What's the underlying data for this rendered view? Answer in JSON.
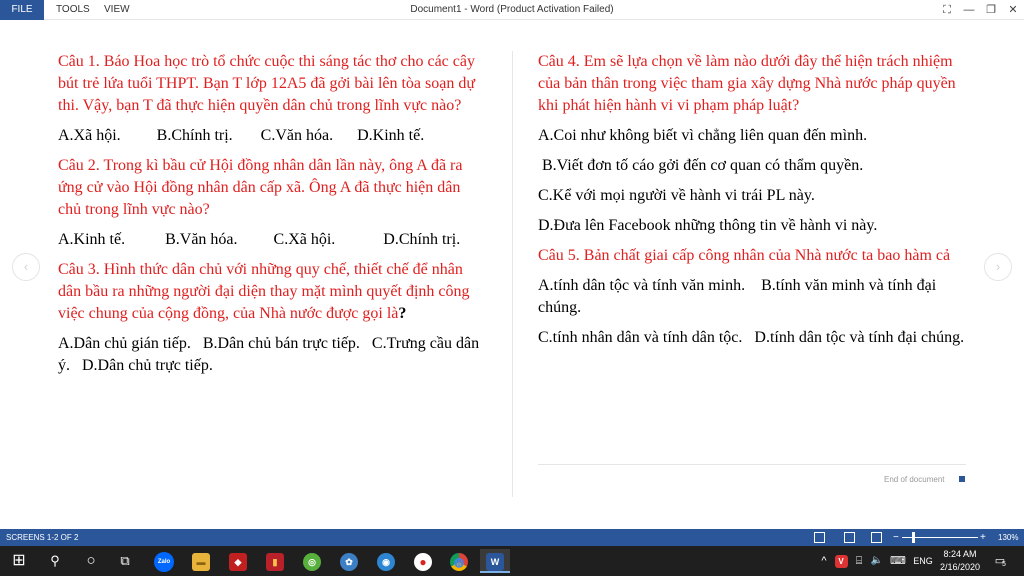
{
  "window": {
    "title": "Document1 - Word (Product Activation Failed)",
    "menu": {
      "file": "FILE",
      "tools": "TOOLS",
      "view": "VIEW"
    },
    "controls": {
      "toolbar": "⛶",
      "minimize": "—",
      "maximize": "❐",
      "close": "✕"
    }
  },
  "document": {
    "left_column": [
      {
        "type": "question",
        "text": "Câu 1. Báo Hoa học trò tổ chức cuộc thi sáng tác thơ cho các cây bút trẻ lứa tuổi THPT. Bạn T lớp 12A5 đã gởi bài lên tòa soạn dự thi. Vậy, bạn T đã thực hiện quyền dân chủ trong lĩnh vực nào?"
      },
      {
        "type": "answer",
        "text": "A.Xã hội.         B.Chính trị.       C.Văn hóa.      D.Kinh tế."
      },
      {
        "type": "question",
        "text": "Câu 2. Trong kì bầu cử Hội đồng nhân dân lần này, ông A đã ra ứng cử vào Hội đồng nhân dân cấp xã. Ông A đã thực hiện dân chủ trong lĩnh vực nào?"
      },
      {
        "type": "answer",
        "text": "A.Kinh tế.          B.Văn hóa.         C.Xã hội.            D.Chính trị."
      },
      {
        "type": "question",
        "text": "Câu 3. Hình thức dân chủ với những quy chế, thiết chế để nhân dân bầu ra những người đại diện thay mặt mình quyết định công việc chung của cộng đồng, của Nhà nước được gọi là",
        "suffix": "?"
      },
      {
        "type": "answer",
        "text": "A.Dân chủ gián tiếp.   B.Dân chủ bán trực tiếp.   C.Trưng cầu dân ý.   D.Dân chủ trực tiếp."
      }
    ],
    "right_column": {
      "q4": "Câu 4. Em sẽ lựa chọn về làm nào dưới đây thể hiện trách nhiệm của bản thân trong việc tham gia xây dựng Nhà nước pháp quyền khi phát hiện hành vi vi phạm pháp luật?",
      "q4_options": [
        "A.Coi như không biết vì chẳng liên quan đến mình.",
        " B.Viết đơn tố cáo gởi đến cơ quan có thẩm quyền.",
        "C.Kể với mọi người về hành vi trái PL này.",
        "D.Đưa lên Facebook những thông tin về hành vi này."
      ],
      "q5": "Câu 5. Bản chất giai cấp công nhân của Nhà nước ta bao hàm cả",
      "q5_options": [
        "A.tính dân tộc và tính văn minh.    B.tính văn minh và tính đại chúng.",
        "C.tính nhân dân và tính dân tộc.   D.tính dân tộc và tính đại chúng."
      ]
    },
    "end_of_document": "End of document",
    "nav": {
      "prev": "‹",
      "next": "›"
    }
  },
  "statusbar": {
    "screens": "SCREENS 1-2 OF 2",
    "zoom": "130%",
    "zoom_minus": "−",
    "zoom_plus": "+"
  },
  "taskbar": {
    "start": "⊞",
    "search": "⚲",
    "cortana": "○",
    "taskview": "⧉",
    "zalo": "Zalo",
    "explorer": "▬",
    "game1": "◆",
    "game2": "▮",
    "app5": "◎",
    "app6": "✿",
    "app7": "◉",
    "record": "●",
    "chrome": "◍",
    "word": "W",
    "tray": {
      "up": "^",
      "v": "V",
      "network": "⌸",
      "volume": "🔈",
      "keyboard": "⌨",
      "lang": "ENG",
      "time": "8:24 AM",
      "date": "2/16/2020",
      "notifications": "▭",
      "notif_count": "5"
    }
  }
}
